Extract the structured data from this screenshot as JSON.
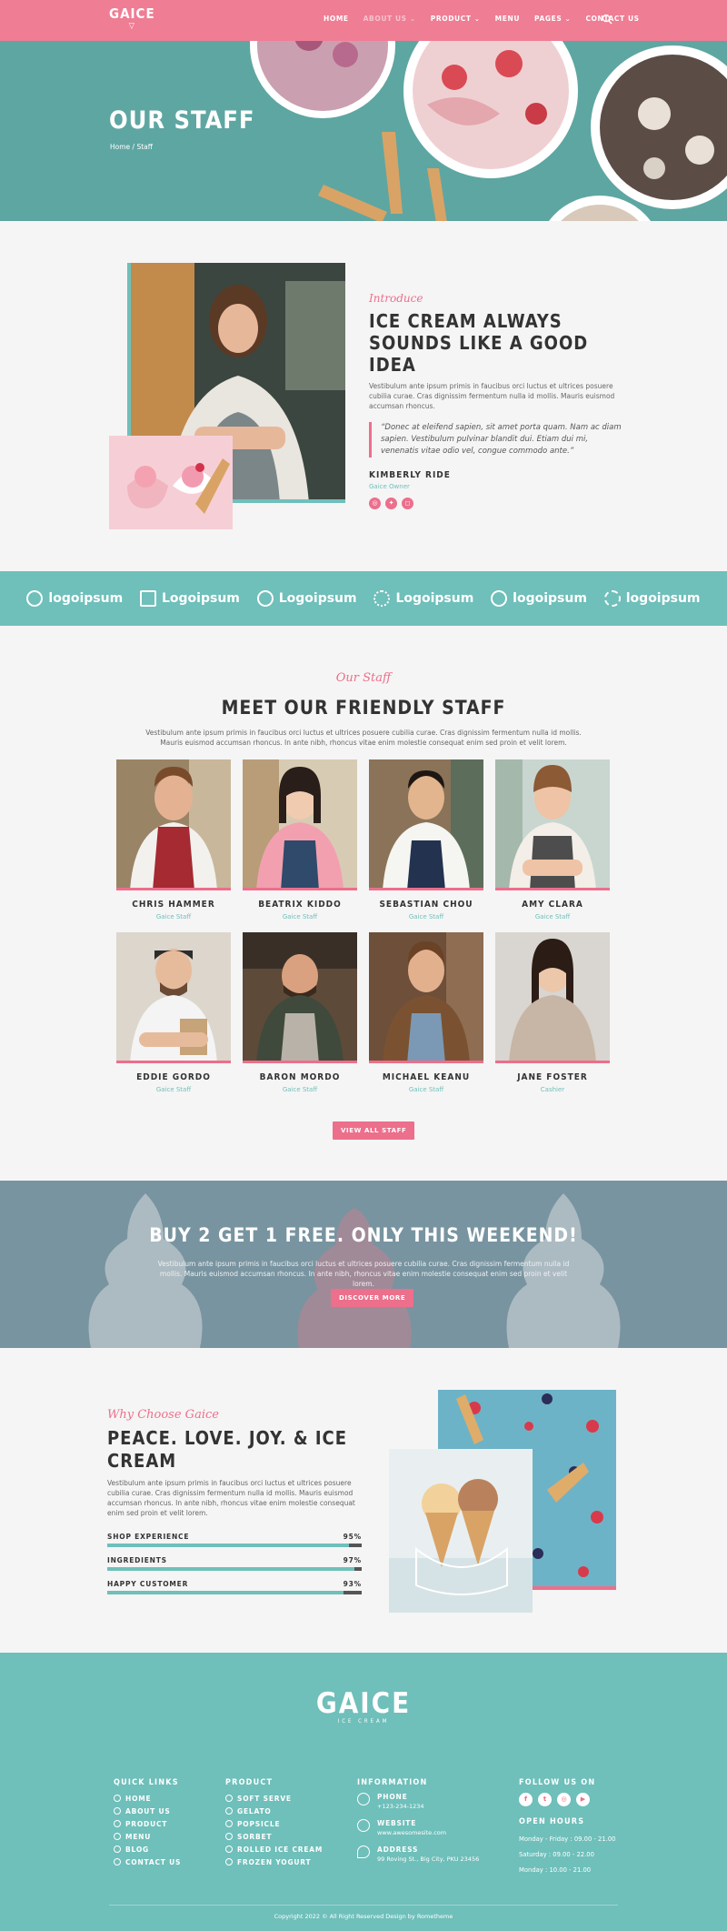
{
  "header": {
    "logo": "GAICE",
    "nav": [
      {
        "label": "HOME",
        "caret": ""
      },
      {
        "label": "ABOUT US",
        "caret": "⌄"
      },
      {
        "label": "PRODUCT",
        "caret": "⌄"
      },
      {
        "label": "MENU",
        "caret": ""
      },
      {
        "label": "PAGES",
        "caret": "⌄"
      },
      {
        "label": "CONTACT US",
        "caret": ""
      }
    ]
  },
  "hero": {
    "title": "OUR STAFF",
    "breadcrumb": "Home / Staff"
  },
  "intro": {
    "script": "Introduce",
    "title": "ICE CREAM ALWAYS SOUNDS LIKE A GOOD IDEA",
    "body": "Vestibulum ante ipsum primis in faucibus orci luctus et ultrices posuere cubilia curae. Cras dignissim fermentum nulla id mollis. Mauris euismod accumsan rhoncus.",
    "quote": "“Donec at eleifend sapien, sit amet porta quam. Nam ac diam sapien. Vestibulum pulvinar blandit dui. Etiam dui mi, venenatis vitae odio vel, congue commodo ante.”",
    "name": "KIMBERLY RIDE",
    "role": "Gaice Owner"
  },
  "logos": [
    "logoipsum",
    "Logoipsum",
    "Logoipsum",
    "Logoipsum",
    "logoipsum",
    "logoipsum"
  ],
  "staff": {
    "script": "Our Staff",
    "title": "MEET OUR FRIENDLY STAFF",
    "body": "Vestibulum ante ipsum primis in faucibus orci luctus et ultrices posuere cubilia curae. Cras dignissim fermentum nulla id mollis. Mauris euismod accumsan rhoncus. In ante nibh, rhoncus vitae enim molestie consequat enim sed proin et velit lorem.",
    "members": [
      {
        "name": "CHRIS HAMMER",
        "role": "Gaice Staff"
      },
      {
        "name": "BEATRIX KIDDO",
        "role": "Gaice Staff"
      },
      {
        "name": "SEBASTIAN CHOU",
        "role": "Gaice Staff"
      },
      {
        "name": "AMY CLARA",
        "role": "Gaice Staff"
      },
      {
        "name": "EDDIE GORDO",
        "role": "Gaice Staff"
      },
      {
        "name": "BARON MORDO",
        "role": "Gaice Staff"
      },
      {
        "name": "MICHAEL KEANU",
        "role": "Gaice Staff"
      },
      {
        "name": "JANE FOSTER",
        "role": "Cashier"
      }
    ],
    "button": "VIEW ALL STAFF"
  },
  "promo": {
    "title": "BUY 2 GET 1 FREE. ONLY THIS WEEKEND!",
    "body": "Vestibulum ante ipsum primis in faucibus orci luctus et ultrices posuere cubilia curae. Cras dignissim fermentum nulla id mollis. Mauris euismod accumsan rhoncus. In ante nibh, rhoncus vitae enim molestie consequat enim sed proin et velit lorem.",
    "button": "DISCOVER MORE"
  },
  "why": {
    "script": "Why Choose Gaice",
    "title": "PEACE. LOVE. JOY. & ICE CREAM",
    "body": "Vestibulum ante ipsum primis in faucibus orci luctus et ultrices posuere cubilia curae. Cras dignissim fermentum nulla id mollis. Mauris euismod accumsan rhoncus. In ante nibh, rhoncus vitae enim molestie consequat enim sed proin et velit lorem.",
    "bars": [
      {
        "label": "SHOP EXPERIENCE",
        "value": "95%",
        "fraction": 0.95
      },
      {
        "label": "INGREDIENTS",
        "value": "97%",
        "fraction": 0.97
      },
      {
        "label": "HAPPY CUSTOMER",
        "value": "93%",
        "fraction": 0.93
      }
    ]
  },
  "footer": {
    "logo": "GAICE",
    "logo_sub": "ICE CREAM",
    "quick_links_title": "QUICK LINKS",
    "quick_links": [
      "HOME",
      "ABOUT US",
      "PRODUCT",
      "MENU",
      "BLOG",
      "CONTACT US"
    ],
    "product_title": "PRODUCT",
    "products": [
      "SOFT SERVE",
      "GELATO",
      "POPSICLE",
      "SORBET",
      "ROLLED ICE CREAM",
      "FROZEN YOGURT"
    ],
    "information_title": "INFORMATION",
    "phone_label": "PHONE",
    "phone": "+123-234-1234",
    "website_label": "WEBSITE",
    "website": "www.awesomesite.com",
    "address_label": "ADDRESS",
    "address": "99 Roving St., Big City, PKU 23456",
    "follow_title": "FOLLOW US ON",
    "hours_title": "OPEN HOURS",
    "hours": [
      "Monday - Friday : 09.00 - 21.00",
      "Saturday : 09.00 - 22.00",
      "Monday : 10.00 - 21.00"
    ],
    "copyright": "Copyright 2022 © All Right Reserved Design by Rometheme"
  },
  "colors": {
    "pink": "#ef7d94",
    "teal": "#6fbfba",
    "slate": "#7e9aa6"
  }
}
